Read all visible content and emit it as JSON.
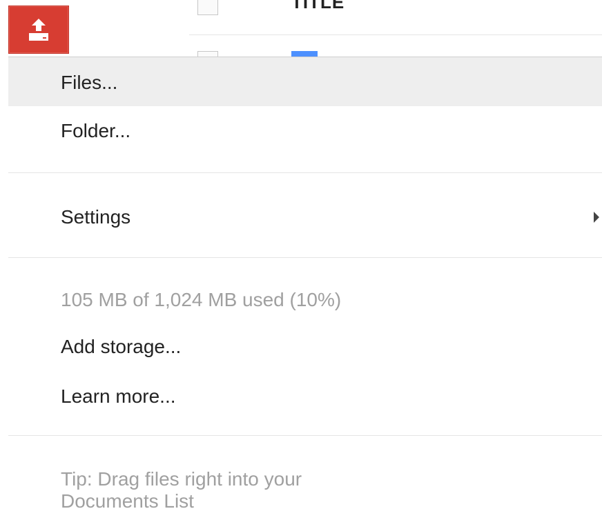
{
  "background_list": {
    "column_title": "TITLE"
  },
  "upload": {
    "icon": "upload-icon",
    "accent_color": "#d73d32"
  },
  "menu": {
    "files_label": "Files...",
    "folder_label": "Folder...",
    "settings_label": "Settings",
    "storage_usage": "105 MB of 1,024 MB used (10%)",
    "add_storage_label": "Add storage...",
    "learn_more_label": "Learn more...",
    "tip": "Tip: Drag files right into your Documents List",
    "highlight_color": "#eeeeee"
  }
}
